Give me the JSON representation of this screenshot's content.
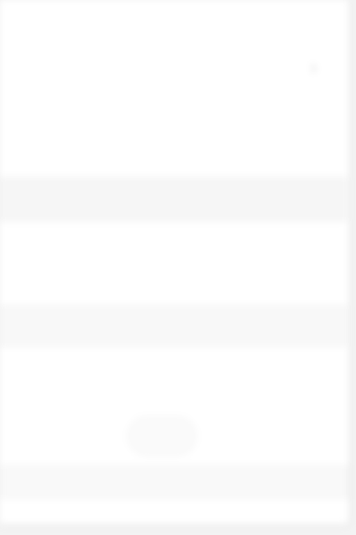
{
  "page_heading": "",
  "link_top": "",
  "subtext_1": "",
  "subtext_2": "",
  "chevron": "›",
  "link_long": "",
  "meta": "",
  "meta_faint": "",
  "box_1_label": "",
  "section_1": {
    "heading": "",
    "subheading": "",
    "tabs": [
      "",
      "",
      "",
      ""
    ]
  },
  "section_2": {
    "heading": "",
    "subheading": "",
    "line": "",
    "pill_label": "",
    "box_label": ""
  },
  "colors": {
    "link": "#3a93d6",
    "link_light": "#5aaef0",
    "panel": "#ffffff",
    "background": "#f3f3f3"
  }
}
